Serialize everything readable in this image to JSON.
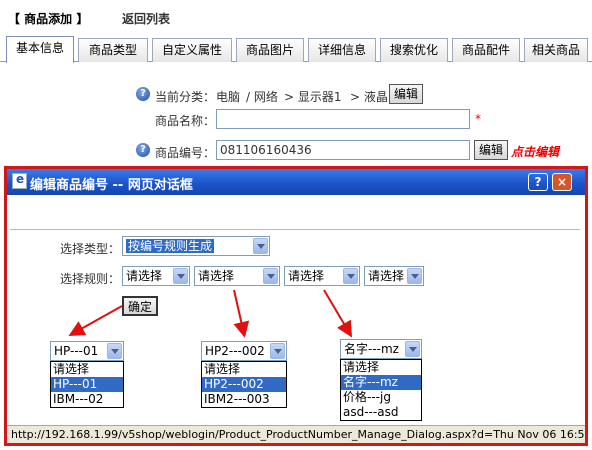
{
  "header": {
    "title": "【 商品添加 】",
    "back_link": "返回列表"
  },
  "tabs": [
    "基本信息",
    "商品类型",
    "自定义属性",
    "商品图片",
    "详细信息",
    "搜索优化",
    "商品配件",
    "相关商品"
  ],
  "form": {
    "category_label": "当前分类：",
    "category_path": [
      "电脑",
      "/ 网络",
      "> 显示器1",
      "> 液晶"
    ],
    "category_edit": "编辑",
    "name_label": "商品名称：",
    "name_value": "",
    "name_required": "*",
    "number_label": "商品编号：",
    "number_value": "081106160436",
    "number_edit": "编辑",
    "number_hint": "点击编辑"
  },
  "dialog": {
    "title": "编辑商品编号 -- 网页对话框",
    "help_btn": "?",
    "close_btn": "×",
    "type_label": "选择类型：",
    "type_value": "按编号规则生成",
    "rule_label": "选择规则：",
    "rule_selects": [
      "请选择",
      "请选择",
      "请选择",
      "请选择"
    ],
    "confirm": "确定",
    "examples": [
      {
        "value": "HP---01",
        "options": [
          "请选择",
          "HP---01",
          "IBM---02"
        ],
        "selected": 1
      },
      {
        "value": "HP2---002",
        "options": [
          "请选择",
          "HP2---002",
          "IBM2---003"
        ],
        "selected": 1
      },
      {
        "value": "名字---mz",
        "options": [
          "请选择",
          "名字---mz",
          "价格---jg",
          "asd---asd"
        ],
        "selected": 1
      }
    ],
    "status_url": "http://192.168.1.99/v5shop/weblogin/Product_ProductNumber_Manage_Dialog.aspx?d=Thu Nov 06 16:5"
  },
  "colors": {
    "dialog_border": "#d01818",
    "title_bar": "#1a52c8",
    "highlight": "#316ac5",
    "hint": "#e00000"
  }
}
